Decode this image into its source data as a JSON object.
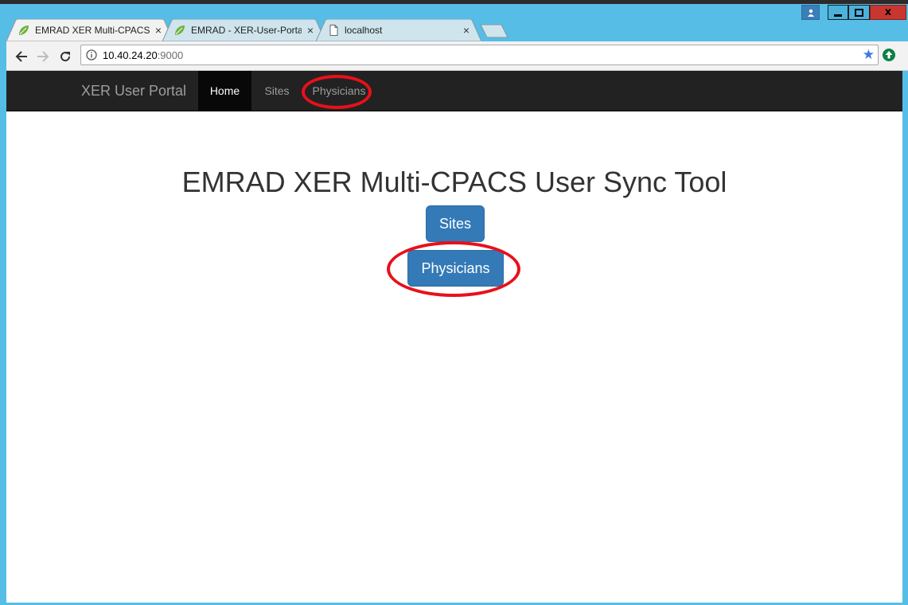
{
  "window": {
    "controls": [
      "user",
      "minimize",
      "maximize",
      "close"
    ],
    "close_glyph": "x"
  },
  "tabs": [
    {
      "title": "EMRAD XER Multi-CPACS",
      "favicon": "spring-leaf-icon",
      "active": true,
      "close": "×"
    },
    {
      "title": "EMRAD - XER-User-Portal",
      "favicon": "spring-leaf-icon",
      "active": false,
      "close": "×"
    },
    {
      "title": "localhost",
      "favicon": "page-icon",
      "active": false,
      "close": "×"
    }
  ],
  "toolbar": {
    "url_host": "10.40.24.20",
    "url_port": ":9000"
  },
  "navbar": {
    "brand": "XER User Portal",
    "items": [
      {
        "label": "Home",
        "active": true
      },
      {
        "label": "Sites",
        "active": false
      },
      {
        "label": "Physicians",
        "active": false
      }
    ]
  },
  "main": {
    "heading": "EMRAD XER Multi-CPACS User Sync Tool",
    "buttons": [
      "Sites",
      "Physicians"
    ]
  },
  "colors": {
    "frame": "#56bde6",
    "navbar": "#222222",
    "primary_button": "#337ab7",
    "annotation": "#e8101a"
  }
}
